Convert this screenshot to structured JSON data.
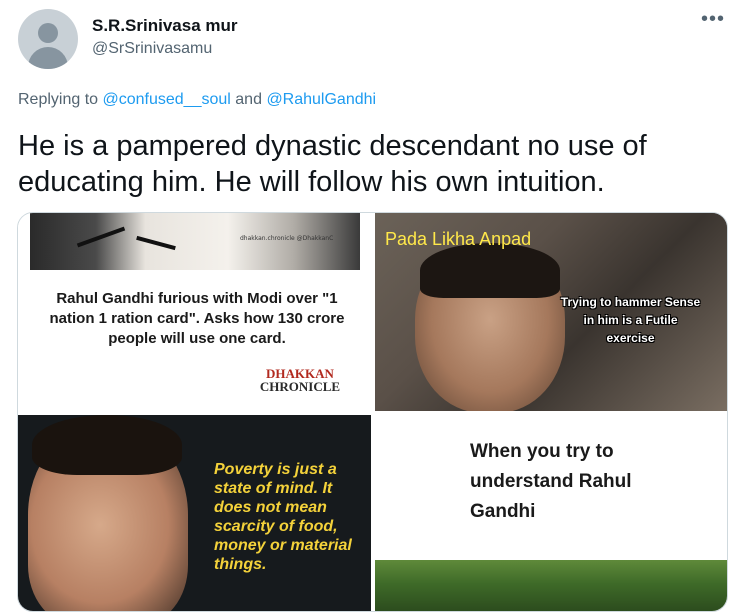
{
  "author": {
    "name": "S.R.Srinivasa mur",
    "handle": "@SrSrinivasamu"
  },
  "reply": {
    "prefix": "Replying to",
    "mention1": "@confused__soul",
    "conjunction": "and",
    "mention2": "@RahulGandhi"
  },
  "tweet": {
    "text": "He is a pampered dynastic descendant no use of educating him. He will follow his own intuition."
  },
  "more_label": "•••",
  "media": {
    "tile1": {
      "headline": "Rahul Gandhi furious with Modi over \"1 nation 1 ration card\". Asks how 130 crore people will use one card.",
      "social_handles": "dhakkan.chronicle  @DhakkanC",
      "brand_line1": "DHAKKAN",
      "brand_line2": "CHRONICLE"
    },
    "tile2": {
      "title": "Pada Likha Anpad",
      "caption": "Trying to hammer Sense in him is a Futile exercise"
    },
    "tile3": {
      "quote": "Poverty is just a state of mind. It does not mean scarcity of food, money or material things."
    },
    "tile4": {
      "text": "When you try to understand Rahul Gandhi"
    }
  },
  "colors": {
    "link": "#1d9bf0",
    "secondary_text": "#536471",
    "primary_text": "#0f1419",
    "caption_yellow": "#f4d23a"
  }
}
